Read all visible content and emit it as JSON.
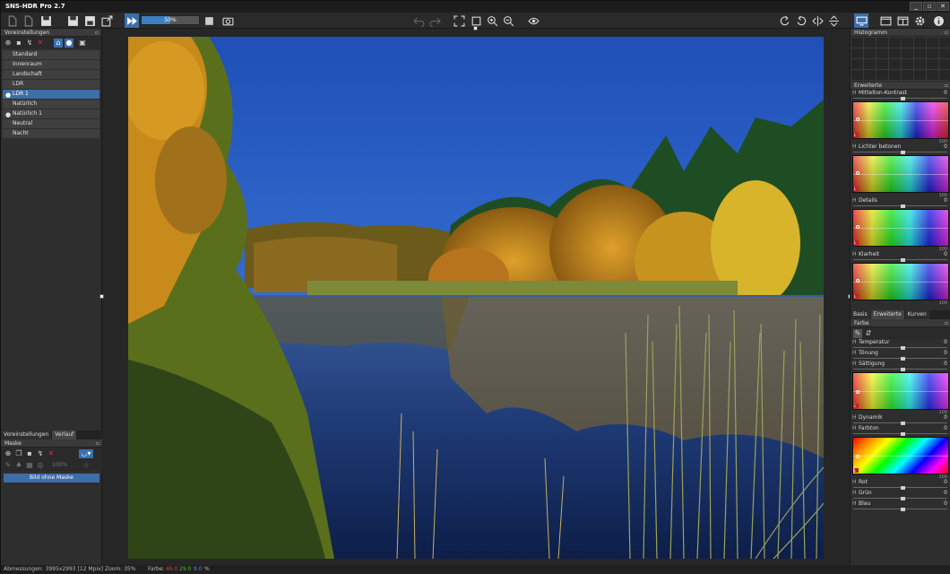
{
  "app": {
    "title": "SNS-HDR Pro 2.7"
  },
  "window_controls": [
    "_",
    "▫",
    "✕"
  ],
  "toolbar": {
    "progress_label": "50%",
    "progress_value": 0.5
  },
  "left": {
    "presets_title": "Voreinstellungen",
    "presets": [
      {
        "label": "Standard",
        "user": false,
        "selected": false
      },
      {
        "label": "Innenraum",
        "user": false,
        "selected": false
      },
      {
        "label": "Landschaft",
        "user": false,
        "selected": false
      },
      {
        "label": "LDR",
        "user": false,
        "selected": false
      },
      {
        "label": "LDR 1",
        "user": true,
        "selected": true
      },
      {
        "label": "Natürlich",
        "user": false,
        "selected": false
      },
      {
        "label": "Natürlich 1",
        "user": true,
        "selected": false
      },
      {
        "label": "Neutral",
        "user": false,
        "selected": false
      },
      {
        "label": "Nacht",
        "user": false,
        "selected": false
      }
    ],
    "tabs": [
      "Voreinstellungen",
      "Verlauf"
    ],
    "mask_title": "Maske",
    "mask_zoom": "100%",
    "mask_button": "Bild ohne Maske"
  },
  "right": {
    "histogram_title": "Histogramm",
    "extended_title": "Erweiterte",
    "sliders_top": [
      {
        "label": "Mittelton-Kontrast",
        "value": "0",
        "gmin": "L",
        "gmax": "100"
      },
      {
        "label": "Lichter betonen",
        "value": "0",
        "gmin": "L",
        "gmax": "100"
      },
      {
        "label": "Details",
        "value": "0",
        "gmin": "L",
        "gmax": "100"
      },
      {
        "label": "Klarheit",
        "value": "0",
        "gmin": "L",
        "gmax": "100"
      }
    ],
    "tabs": [
      "Basis",
      "Erweiterte",
      "Kurven"
    ],
    "color_title": "Farbe",
    "color_sliders": [
      {
        "label": "Temperatur",
        "value": "0"
      },
      {
        "label": "Tönung",
        "value": "0"
      },
      {
        "label": "Sättigung",
        "value": "0"
      }
    ],
    "dyn_sliders": [
      {
        "label": "Dynamik",
        "value": "0"
      },
      {
        "label": "Farbton",
        "value": "0"
      }
    ],
    "rgb_sliders": [
      {
        "label": "Rot",
        "value": "0"
      },
      {
        "label": "Grün",
        "value": "0"
      },
      {
        "label": "Blau",
        "value": "0"
      }
    ],
    "grad_max": "100",
    "grad_min": "L"
  },
  "status": {
    "dimensions": "Abmessungen: 3995x2993 [12 Mpix]",
    "zoom": "Zoom: 35%",
    "color_label": "Farbe:",
    "r": "46.0",
    "g": "29.0",
    "b": "9.0",
    "pct": "%"
  },
  "colors": {
    "accent": "#3c6ea9",
    "sky": "#2a5ec4",
    "panel": "#2e2e2e"
  }
}
